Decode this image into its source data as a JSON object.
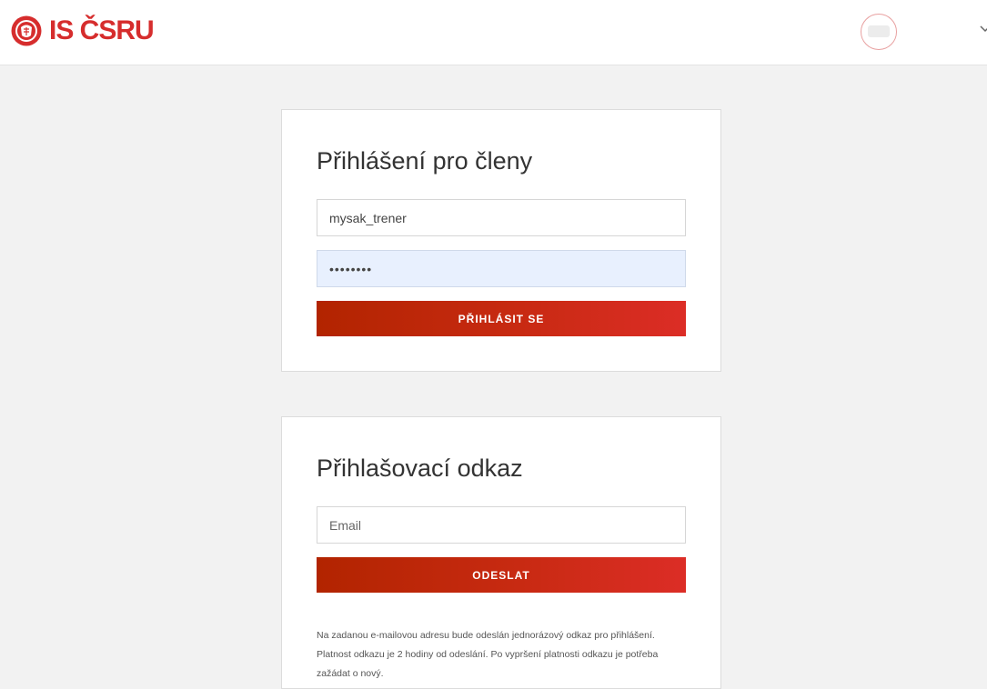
{
  "header": {
    "logo_text": "IS ČSRU",
    "brand_color": "#d62d2d"
  },
  "login": {
    "title": "Přihlášení pro členy",
    "username_value": "mysak_trener",
    "password_value": "********",
    "submit_label": "PŘIHLÁSIT SE"
  },
  "magic_link": {
    "title": "Přihlašovací odkaz",
    "email_placeholder": "Email",
    "email_value": "",
    "submit_label": "ODESLAT",
    "note": "Na zadanou e-mailovou adresu bude odeslán jednorázový odkaz pro přihlášení. Platnost odkazu je 2 hodiny od odeslání. Po vypršení platnosti odkazu je potřeba zažádat o nový."
  },
  "colors": {
    "accent": "#c62a10",
    "background": "#f2f2f2",
    "autofill": "#e8f0fe"
  }
}
